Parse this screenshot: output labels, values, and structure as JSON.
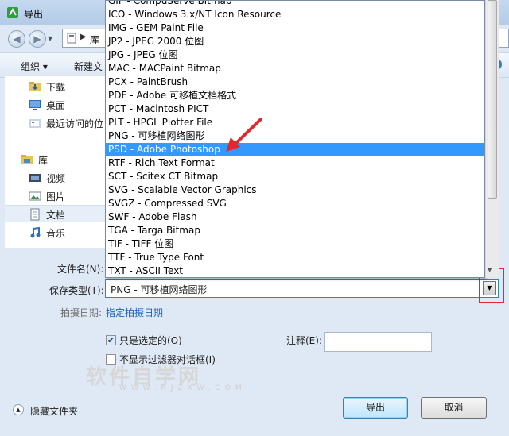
{
  "window": {
    "title": "导出"
  },
  "nav": {
    "address": "库",
    "back_glyph": "◀",
    "forward_glyph": "▶"
  },
  "toolbar": {
    "organize": "组织 ▾",
    "new_folder": "新建文"
  },
  "sidebar": {
    "items": [
      {
        "label": "下载",
        "icon": "download-folder-icon",
        "kind": "child"
      },
      {
        "label": "桌面",
        "icon": "desktop-icon",
        "kind": "child"
      },
      {
        "label": "最近访问的位",
        "icon": "recent-places-icon",
        "kind": "child"
      },
      {
        "label": "库",
        "icon": "library-icon",
        "kind": "head"
      },
      {
        "label": "视频",
        "icon": "video-icon",
        "kind": "child"
      },
      {
        "label": "图片",
        "icon": "pictures-icon",
        "kind": "child"
      },
      {
        "label": "文档",
        "icon": "documents-icon",
        "kind": "child",
        "selected": true
      },
      {
        "label": "音乐",
        "icon": "music-icon",
        "kind": "child"
      }
    ]
  },
  "dropdown": {
    "selected_index": 11,
    "options": [
      "GIF - CompuServe Bitmap",
      "ICO - Windows 3.x/NT Icon Resource",
      "IMG - GEM Paint File",
      "JP2 - JPEG 2000 位图",
      "JPG - JPEG 位图",
      "MAC - MACPaint Bitmap",
      "PCX - PaintBrush",
      "PDF - Adobe 可移植文档格式",
      "PCT - Macintosh PICT",
      "PLT - HPGL Plotter File",
      "PNG - 可移植网络图形",
      "PSD - Adobe Photoshop",
      "RTF - Rich Text Format",
      "SCT - Scitex CT Bitmap",
      "SVG - Scalable Vector Graphics",
      "SVGZ - Compressed SVG",
      "SWF - Adobe Flash",
      "TGA - Targa Bitmap",
      "TIF - TIFF 位图",
      "TTF - True Type Font",
      "TXT - ASCII Text"
    ]
  },
  "form": {
    "filename_label": "文件名(N):",
    "savetype_label": "保存类型(T):",
    "savetype_value": "PNG - 可移植网络图形",
    "date_label": "拍摄日期:",
    "date_link": "指定拍摄日期",
    "selected_only_label": "只是选定的(O)",
    "selected_only_checked": true,
    "no_filter_label": "不显示过滤器对话框(I)",
    "no_filter_checked": false,
    "notes_label": "注释(E):",
    "notes_value": ""
  },
  "footer": {
    "hide_folders": "隐藏文件夹",
    "export": "导出",
    "cancel": "取消"
  },
  "watermark": {
    "main": "软件自学网",
    "sub": "WWW.RJZXW.COM"
  },
  "colors": {
    "selection": "#3399ff",
    "highlight_box": "#e3282d",
    "annotation_arrow": "#e3282d"
  }
}
